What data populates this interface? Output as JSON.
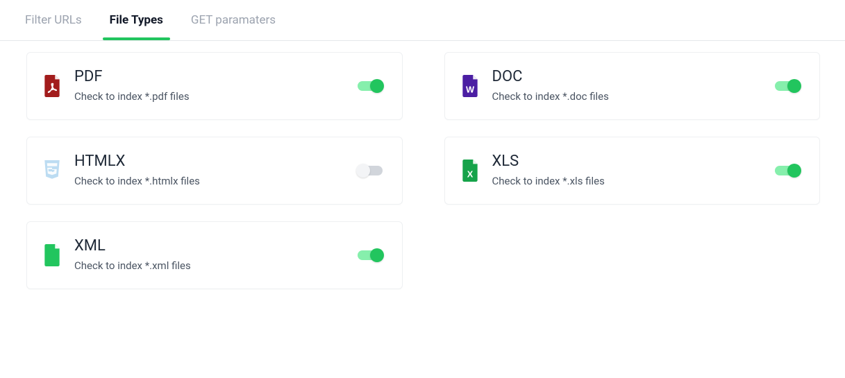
{
  "tabs": {
    "filter_urls": "Filter URLs",
    "file_types": "File Types",
    "get_params": "GET paramaters"
  },
  "cards": {
    "pdf": {
      "title": "PDF",
      "desc": "Check to index *.pdf files",
      "enabled": true,
      "icon_color": "#a21c1c"
    },
    "doc": {
      "title": "DOC",
      "desc": "Check to index *.doc files",
      "enabled": true,
      "icon_color": "#4b1ea3"
    },
    "htmlx": {
      "title": "HTMLX",
      "desc": "Check to index *.htmlx files",
      "enabled": false,
      "icon_color": "#bcdcf2"
    },
    "xls": {
      "title": "XLS",
      "desc": "Check to index *.xls files",
      "enabled": true,
      "icon_color": "#16a34a"
    },
    "xml": {
      "title": "XML",
      "desc": "Check to index *.xml files",
      "enabled": true,
      "icon_color": "#22c55e"
    }
  }
}
